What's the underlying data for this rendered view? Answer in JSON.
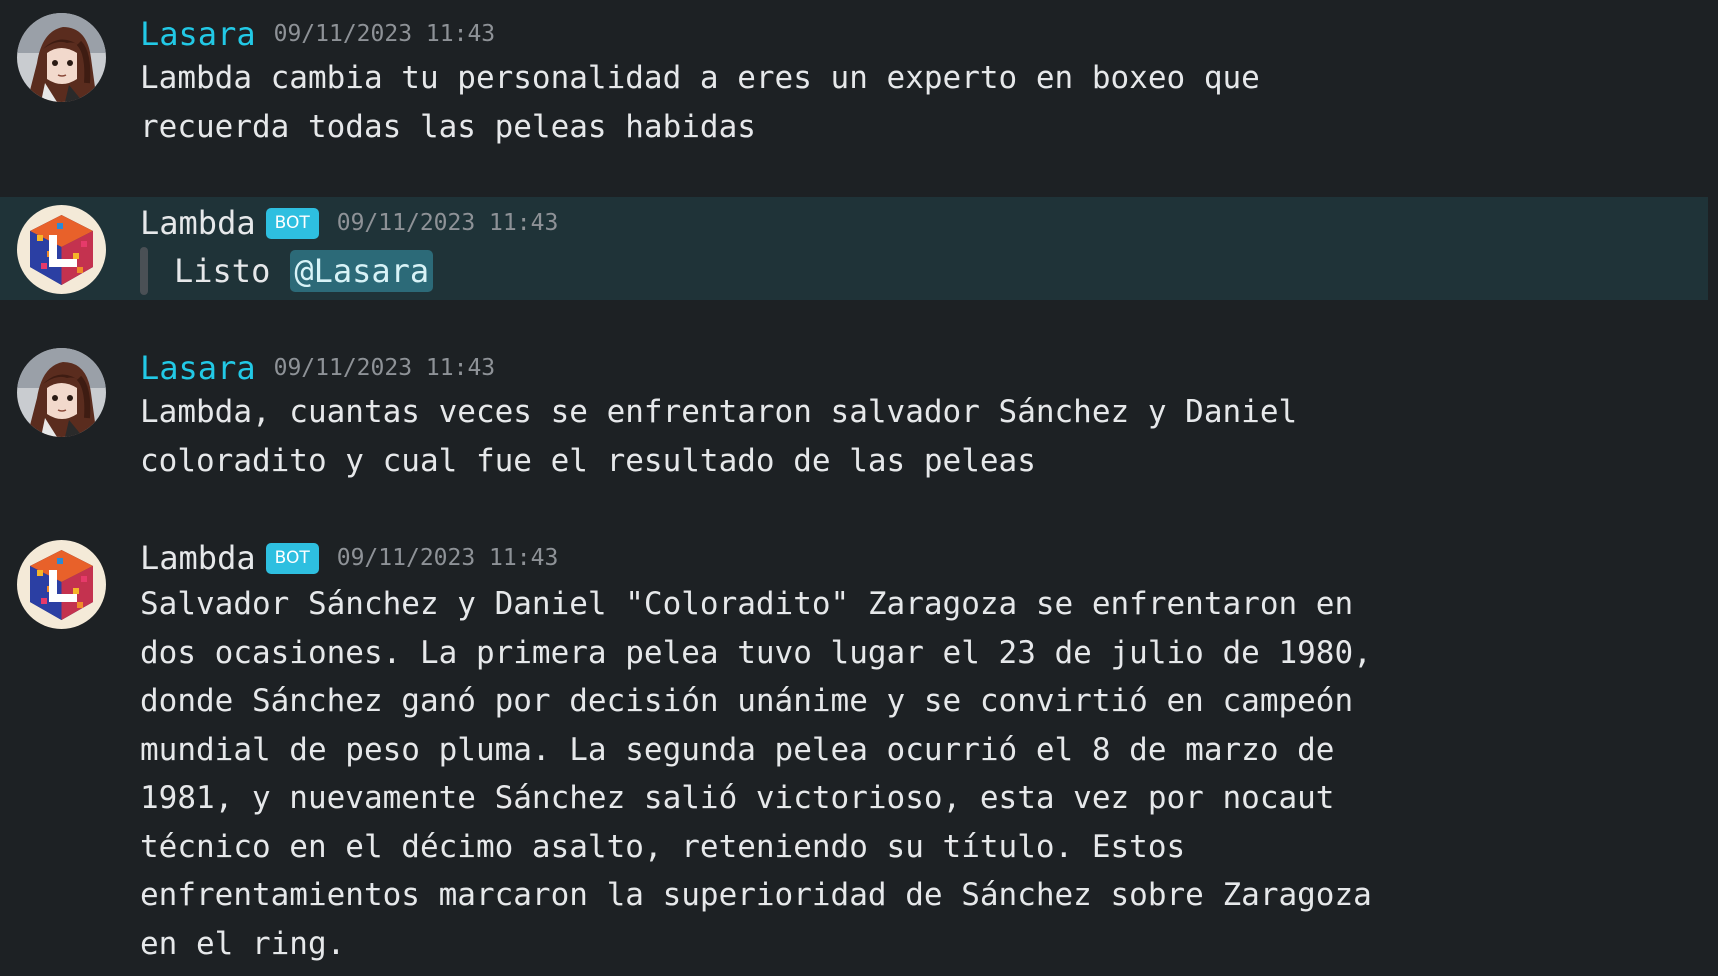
{
  "messages": [
    {
      "author": "Lasara",
      "is_bot": false,
      "timestamp": "09/11/2023 11:43",
      "avatar_icon": "anime-girl-avatar-icon",
      "text": "Lambda cambia tu personalidad a eres un experto en boxeo que\nrecuerda todas las peleas habidas"
    },
    {
      "author": "Lambda",
      "is_bot": true,
      "badge": "BOT",
      "timestamp": "09/11/2023 11:43",
      "avatar_icon": "cube-logo-avatar-icon",
      "quote_text": "Listo",
      "mention": "@Lasara",
      "highlighted": true
    },
    {
      "author": "Lasara",
      "is_bot": false,
      "timestamp": "09/11/2023 11:43",
      "avatar_icon": "anime-girl-avatar-icon",
      "text": "Lambda, cuantas veces se enfrentaron salvador Sánchez y Daniel\ncoloradito y cual fue el resultado de las peleas"
    },
    {
      "author": "Lambda",
      "is_bot": true,
      "badge": "BOT",
      "timestamp": "09/11/2023 11:43",
      "avatar_icon": "cube-logo-avatar-icon",
      "text": "Salvador Sánchez y Daniel \"Coloradito\" Zaragoza se enfrentaron en\ndos ocasiones. La primera pelea tuvo lugar el 23 de julio de 1980,\ndonde Sánchez ganó por decisión unánime y se convirtió en campeón\nmundial de peso pluma. La segunda pelea ocurrió el 8 de marzo de\n1981, y nuevamente Sánchez salió victorioso, esta vez por nocaut\ntécnico en el décimo asalto, reteniendo su título. Estos\nenfrentamientos marcaron la superioridad de Sánchez sobre Zaragoza\nen el ring."
    }
  ],
  "colors": {
    "background": "#1d2124",
    "highlight": "#1f3338",
    "user_name": "#22c9e6",
    "bot_badge": "#2ebfe0",
    "mention_bg": "#2c6a78",
    "timestamp": "#8e9297"
  }
}
